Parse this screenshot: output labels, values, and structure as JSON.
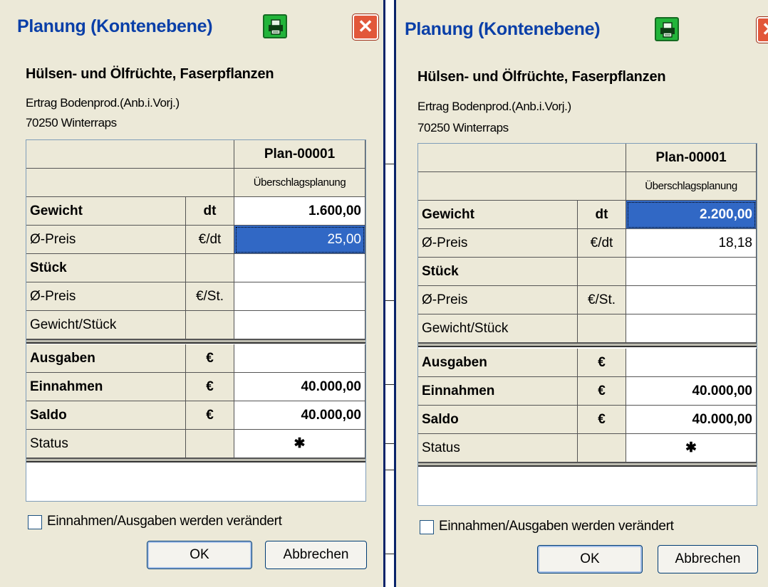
{
  "dialogs": [
    {
      "title": "Planung (Kontenebene)",
      "group": "Hülsen- und Ölfrüchte, Faserpflanzen",
      "account_type": "Ertrag Bodenprod.(Anb.i.Vorj.)",
      "account": "70250 Winterraps",
      "plan_header": "Plan-00001",
      "plan_mode": "Überschlagsplanung",
      "rows": [
        {
          "label": "Gewicht",
          "unit": "dt",
          "value": "1.600,00",
          "bold": true,
          "selected": false
        },
        {
          "label": "Ø-Preis",
          "unit": "€/dt",
          "value": "25,00",
          "bold": false,
          "selected": true
        },
        {
          "label": "Stück",
          "unit": "",
          "value": "",
          "bold": true,
          "selected": false
        },
        {
          "label": "Ø-Preis",
          "unit": "€/St.",
          "value": "",
          "bold": false,
          "selected": false
        },
        {
          "label": "Gewicht/Stück",
          "unit": "",
          "value": "",
          "bold": false,
          "selected": false
        }
      ],
      "rows2": [
        {
          "label": "Ausgaben",
          "unit": "€",
          "value": "",
          "bold": true
        },
        {
          "label": "Einnahmen",
          "unit": "€",
          "value": "40.000,00",
          "bold": true
        },
        {
          "label": "Saldo",
          "unit": "€",
          "value": "40.000,00",
          "bold": true
        },
        {
          "label": "Status",
          "unit": "",
          "value": "✱",
          "bold": false
        }
      ],
      "checkbox_label": "Einnahmen/Ausgaben werden verändert",
      "checkbox_checked": false,
      "ok_label": "OK",
      "cancel_label": "Abbrechen"
    },
    {
      "title": "Planung (Kontenebene)",
      "group": "Hülsen- und Ölfrüchte, Faserpflanzen",
      "account_type": "Ertrag Bodenprod.(Anb.i.Vorj.)",
      "account": "70250 Winterraps",
      "plan_header": "Plan-00001",
      "plan_mode": "Überschlagsplanung",
      "rows": [
        {
          "label": "Gewicht",
          "unit": "dt",
          "value": "2.200,00",
          "bold": true,
          "selected": true
        },
        {
          "label": "Ø-Preis",
          "unit": "€/dt",
          "value": "18,18",
          "bold": false,
          "selected": false
        },
        {
          "label": "Stück",
          "unit": "",
          "value": "",
          "bold": true,
          "selected": false
        },
        {
          "label": "Ø-Preis",
          "unit": "€/St.",
          "value": "",
          "bold": false,
          "selected": false
        },
        {
          "label": "Gewicht/Stück",
          "unit": "",
          "value": "",
          "bold": false,
          "selected": false
        }
      ],
      "rows2": [
        {
          "label": "Ausgaben",
          "unit": "€",
          "value": "",
          "bold": true
        },
        {
          "label": "Einnahmen",
          "unit": "€",
          "value": "40.000,00",
          "bold": true
        },
        {
          "label": "Saldo",
          "unit": "€",
          "value": "40.000,00",
          "bold": true
        },
        {
          "label": "Status",
          "unit": "",
          "value": "✱",
          "bold": false
        }
      ],
      "checkbox_label": "Einnahmen/Ausgaben werden verändert",
      "checkbox_checked": false,
      "ok_label": "OK",
      "cancel_label": "Abbrechen"
    }
  ],
  "icons": {
    "print": "printer-icon",
    "close": "close-icon",
    "status": "asterisk-icon"
  },
  "colors": {
    "title_text": "#0a3fa8",
    "dialog_bg": "#ece9d8",
    "selection": "#3168c5",
    "print_button": "#22b43a",
    "close_button": "#e2573a"
  }
}
